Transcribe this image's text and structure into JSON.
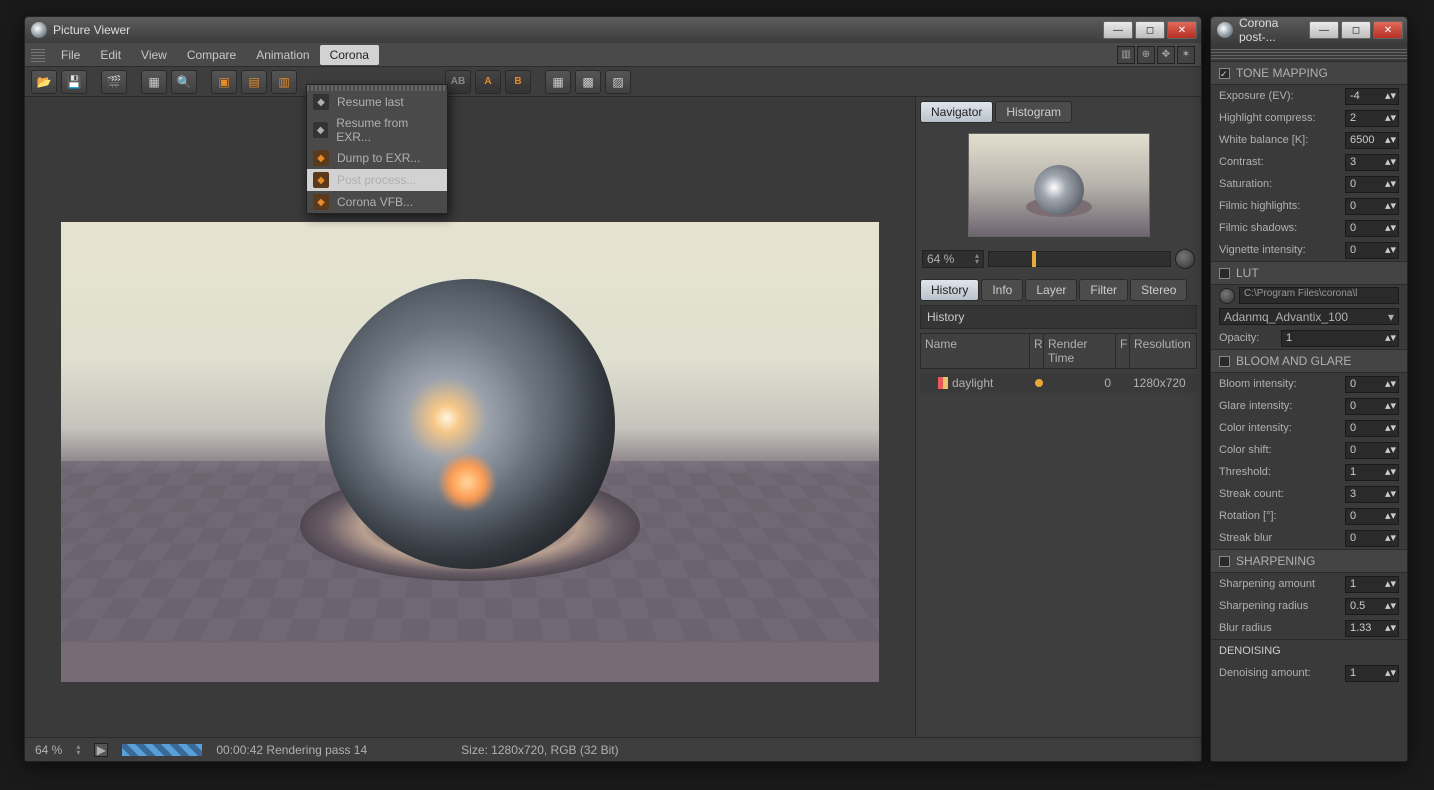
{
  "mainWindow": {
    "title": "Picture Viewer",
    "menu": [
      "File",
      "Edit",
      "View",
      "Compare",
      "Animation",
      "Corona"
    ],
    "activeMenu": "Corona",
    "dropdown": [
      {
        "label": "Resume last",
        "enabled": false
      },
      {
        "label": "Resume from EXR...",
        "enabled": false
      },
      {
        "label": "Dump to EXR...",
        "enabled": true
      },
      {
        "label": "Post process...",
        "enabled": true,
        "hover": true
      },
      {
        "label": "Corona VFB...",
        "enabled": true
      }
    ],
    "nav": {
      "tabs": [
        "Navigator",
        "Histogram"
      ],
      "active": "Navigator",
      "zoom": "64 %"
    },
    "lowerTabs": [
      "History",
      "Info",
      "Layer",
      "Filter",
      "Stereo"
    ],
    "lowerActive": "History",
    "history": {
      "title": "History",
      "cols": {
        "name": "Name",
        "r": "R",
        "rendertime": "Render Time",
        "f": "F",
        "res": "Resolution"
      },
      "row": {
        "name": "daylight",
        "rendertime": "0",
        "res": "1280x720"
      }
    },
    "status": {
      "zoom": "64 %",
      "time": "00:00:42 Rendering pass 14",
      "size": "Size: 1280x720, RGB (32 Bit)"
    }
  },
  "sideWindow": {
    "title": "Corona post-...",
    "sections": {
      "tonemapping": {
        "title": "TONE MAPPING",
        "on": true,
        "items": [
          {
            "label": "Exposure (EV):",
            "v": "-4"
          },
          {
            "label": "Highlight compress:",
            "v": "2"
          },
          {
            "label": "White balance [K]:",
            "v": "6500"
          },
          {
            "label": "Contrast:",
            "v": "3"
          },
          {
            "label": "Saturation:",
            "v": "0"
          },
          {
            "label": "Filmic highlights:",
            "v": "0"
          },
          {
            "label": "Filmic shadows:",
            "v": "0"
          },
          {
            "label": "Vignette intensity:",
            "v": "0"
          }
        ]
      },
      "lut": {
        "title": "LUT",
        "on": false,
        "path": "C:\\Program Files\\corona\\l",
        "preset": "Adanmq_Advantix_100",
        "opacity": {
          "label": "Opacity:",
          "v": "1"
        }
      },
      "bloom": {
        "title": "BLOOM AND GLARE",
        "on": false,
        "items": [
          {
            "label": "Bloom intensity:",
            "v": "0"
          },
          {
            "label": "Glare intensity:",
            "v": "0"
          },
          {
            "label": "Color intensity:",
            "v": "0"
          },
          {
            "label": "Color shift:",
            "v": "0"
          },
          {
            "label": "Threshold:",
            "v": "1"
          },
          {
            "label": "Streak count:",
            "v": "3"
          },
          {
            "label": "Rotation [°]:",
            "v": "0"
          },
          {
            "label": "Streak blur",
            "v": "0"
          }
        ]
      },
      "sharpen": {
        "title": "SHARPENING",
        "on": false,
        "items": [
          {
            "label": "Sharpening amount",
            "v": "1"
          },
          {
            "label": "Sharpening radius",
            "v": "0.5"
          },
          {
            "label": "Blur radius",
            "v": "1.33"
          }
        ]
      },
      "denoise": {
        "title": "DENOISING",
        "items": [
          {
            "label": "Denoising amount:",
            "v": "1"
          }
        ]
      }
    }
  }
}
